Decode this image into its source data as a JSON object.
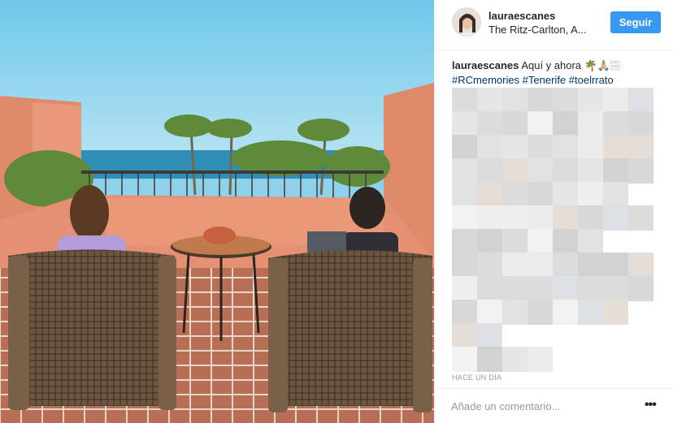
{
  "post": {
    "username": "lauraescanes",
    "location": "The Ritz-Carlton, A...",
    "follow_label": "Seguir"
  },
  "caption": {
    "username": "lauraescanes",
    "text": "Aquí y ahora 🌴🙏🏼🏼",
    "hashtags": "#RCmemories #Tenerife #toelrrato"
  },
  "timestamp": "HACE UN DÍA",
  "comment": {
    "placeholder": "Añade un comentario..."
  },
  "more_label": "•••",
  "colors": {
    "follow_button": "#3897f0",
    "hashtag": "#003569",
    "muted": "#999999"
  }
}
